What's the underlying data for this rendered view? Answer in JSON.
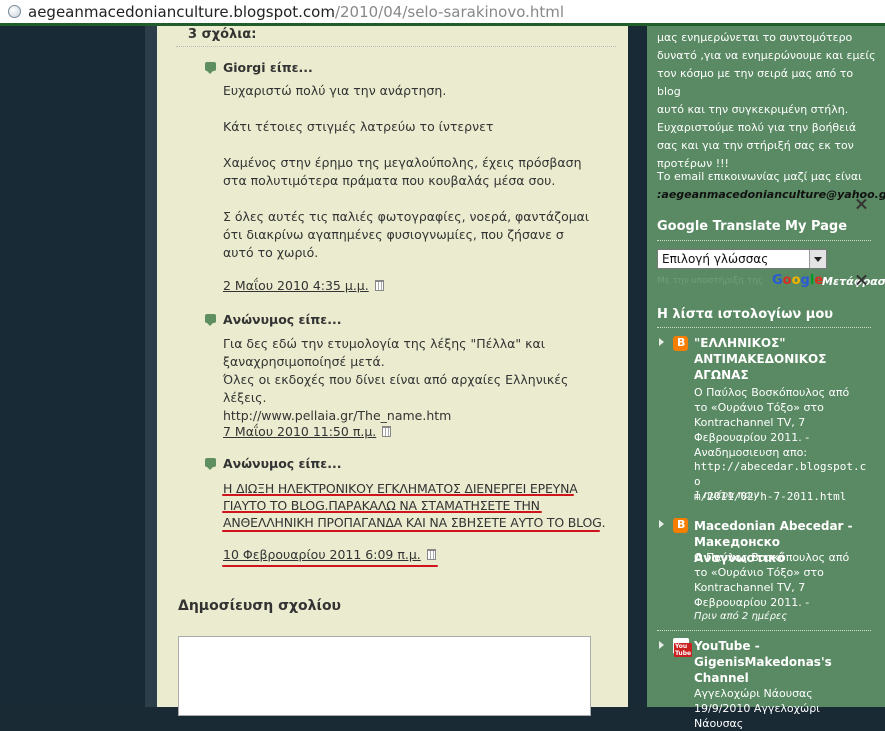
{
  "browser": {
    "url_domain": "aegeanmacedonianculture.blogspot.com",
    "url_path": "/2010/04/selo-sarakinovo.html"
  },
  "comments": {
    "heading": "3 σχόλια:",
    "items": [
      {
        "author": "Giorgi είπε...",
        "paragraphs": [
          "Ευχαριστώ πολύ για την ανάρτηση.",
          "Κάτι τέτοιες στιγμές λατρεύω το ίντερνετ",
          "Χαμένος στην έρημο της μεγαλούπολης, έχεις πρόσβαση στα πολυτιμότερα πράματα που κουβαλάς μέσα σου.",
          "Σ όλες αυτές τις παλιές φωτογραφίες, νοερά, φαντάζομαι ότι διακρίνω αγαπημένες φυσιογνωμίες, που ζήσανε σ αυτό το χωριό."
        ],
        "date": "2 Μαΐου 2010 4:35 μ.μ."
      },
      {
        "author": "Ανώνυμος είπε...",
        "lines": [
          "Για δες εδώ την ετυμολογία της λέξης \"Πέλλα\" και",
          "ξαναχρησιμοποίησέ μετά.",
          "Όλες οι εκδοχές που δίνει είναι από αρχαίες Ελληνικές λέξεις.",
          "http://www.pellaia.gr/The_name.htm"
        ],
        "date": "7 Μαΐου 2010 11:50 π.μ."
      },
      {
        "author": "Ανώνυμος είπε...",
        "lines": [
          "Η ΔΙΩΞΗ ΗΛΕΚΤΡΟΝΙΚΟΥ ΕΓΚΛΗΜΑΤΟΣ ΔΙΕΝΕΡΓΕΙ ΕΡΕΥΝΑ",
          "ΓΙΑΥΤΟ ΤΟ BLOG.ΠΑΡΑΚΑΛΩ ΝΑ ΣΤΑΜΑΤΗΣΕΤΕ ΤΗΝ",
          "ΑΝΘΕΛΛΗΝΙΚΗ ΠΡΟΠΑΓΑΝΔΑ ΚΑΙ ΝΑ ΣΒΗΣΕΤΕ ΑΥΤΟ ΤΟ BLOG."
        ],
        "date": "10 Φεβρουαρίου 2011 6:09 π.μ."
      }
    ],
    "post_heading": "Δημοσίευση σχολίου"
  },
  "sidebar": {
    "intro_lines": [
      "μας ενημερώνεται το συντομότερο",
      "δυνατό ,για να ενημερώνουμε και εμείς",
      "τον κόσμο με την σειρά μας από το blog",
      "αυτό και την συγκεκριμένη στήλη.",
      "Ευχαριστούμε πολύ για την βοήθειά",
      "σας και για την στήριξή σας εκ τον",
      "προτέρων !!!"
    ],
    "email_label": "Το email επικοινωνίας μαζί μας είναι",
    "email": ":aegeanmacedonianculture@yahoo.gr",
    "translate_heading": "Google Translate My Page",
    "language_select": "Επιλογή γλώσσας",
    "powered_by": "Με την υποστήριξη της",
    "google_logo": "Google",
    "translate_link": "Μετάφραση",
    "bloglist_heading": "Η λίστα ιστολογίων μου",
    "blogs": [
      {
        "title_lines": [
          "\"ΕΛΛΗΝΙΚΟΣ\"",
          "ΑΝΤΙΜΑΚΕΔΟΝΙΚΟΣ",
          "ΑΓΩΝΑΣ"
        ],
        "snippet_lines": [
          "Ο Παύλος Βοσκόπουλος από",
          "το «Ουράνιο Τόξο» στο",
          "Kontrachannel TV, 7",
          "Φεβρουαρίου 2011. -",
          "Αναδημοσιευση απο:"
        ],
        "url_lines": [
          "http://abecedar.blogspot.co",
          "m/2011/02/h-7-2011.html"
        ],
        "ago": "1 ημέρα πριν"
      },
      {
        "title_lines": [
          "Macedonian Abecedar -",
          "Македонско Αναγνωστικό"
        ],
        "snippet_lines": [
          "Ο Παύλος Βοσκόπουλος από",
          "το «Ουράνιο Τόξο» στο",
          "Kontrachannel TV, 7",
          "Φεβρουαρίου 2011. -"
        ],
        "ago": "Πριν από 2 ημέρες"
      },
      {
        "title_lines": [
          "YouTube -",
          "GigenisMakedonas's",
          "Channel"
        ],
        "snippet_lines": [
          "Αγγελοχώρι Νάουσας",
          "19/9/2010 Αγγελοχώρι Νάουσας"
        ],
        "yt_label": "You Tube"
      }
    ]
  },
  "colors": {
    "main_bg": "#ebeccf",
    "sidebar_bg": "#5a8a63",
    "page_bg": "#172a36",
    "annotation_red": "#d0141e"
  }
}
